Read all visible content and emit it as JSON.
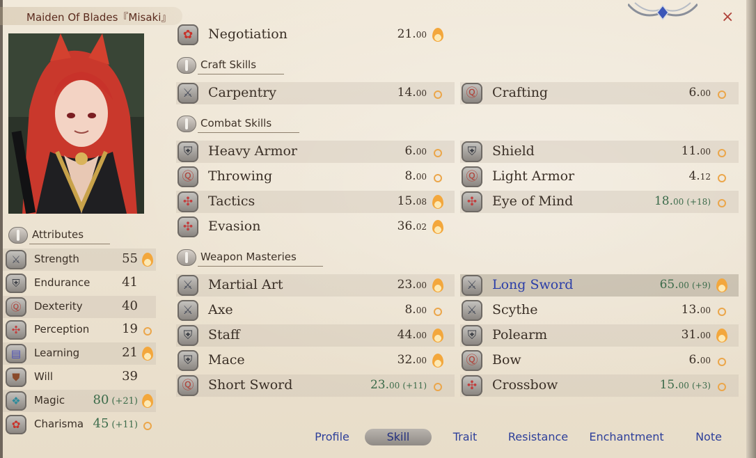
{
  "window": {
    "title": "Maiden Of Blades『Misaki』",
    "close_label": "×"
  },
  "attributes_header": "Attributes",
  "attributes": [
    {
      "name": "Strength",
      "value": "55",
      "bonus": "",
      "potential": "flame",
      "icon": "crossed-swords-icon"
    },
    {
      "name": "Endurance",
      "value": "41",
      "bonus": "",
      "potential": "none",
      "icon": "armor-icon"
    },
    {
      "name": "Dexterity",
      "value": "40",
      "bonus": "",
      "potential": "none",
      "icon": "dexterity-icon"
    },
    {
      "name": "Perception",
      "value": "19",
      "bonus": "",
      "potential": "dot",
      "icon": "perception-icon"
    },
    {
      "name": "Learning",
      "value": "21",
      "bonus": "",
      "potential": "flame",
      "icon": "book-icon"
    },
    {
      "name": "Will",
      "value": "39",
      "bonus": "",
      "potential": "none",
      "icon": "will-icon"
    },
    {
      "name": "Magic",
      "value": "80",
      "bonus": "(+21)",
      "potential": "flame",
      "icon": "magic-icon"
    },
    {
      "name": "Charisma",
      "value": "45",
      "bonus": "(+11)",
      "potential": "dot",
      "icon": "charisma-icon"
    }
  ],
  "top_skill": {
    "name": "Negotiation",
    "value": "21.",
    "decimal": "00",
    "bonus": "",
    "potential": "flame",
    "icon": "charisma-icon"
  },
  "sections": {
    "craft": "Craft Skills",
    "combat": "Combat Skills",
    "weapon": "Weapon Masteries"
  },
  "craft_skills": [
    {
      "name": "Carpentry",
      "value": "14.",
      "decimal": "00",
      "bonus": "",
      "potential": "dot",
      "icon": "crossed-swords-icon"
    },
    {
      "name": "Crafting",
      "value": "6.",
      "decimal": "00",
      "bonus": "",
      "potential": "dot",
      "icon": "dexterity-icon"
    }
  ],
  "combat_skills": [
    {
      "name": "Heavy Armor",
      "value": "6.",
      "decimal": "00",
      "bonus": "",
      "potential": "dot",
      "icon": "armor-icon"
    },
    {
      "name": "Shield",
      "value": "11.",
      "decimal": "00",
      "bonus": "",
      "potential": "dot",
      "icon": "armor-icon"
    },
    {
      "name": "Throwing",
      "value": "8.",
      "decimal": "00",
      "bonus": "",
      "potential": "dot",
      "icon": "dexterity-icon"
    },
    {
      "name": "Light Armor",
      "value": "4.",
      "decimal": "12",
      "bonus": "",
      "potential": "dot",
      "icon": "dexterity-icon"
    },
    {
      "name": "Tactics",
      "value": "15.",
      "decimal": "08",
      "bonus": "",
      "potential": "flame",
      "icon": "perception-icon"
    },
    {
      "name": "Eye of Mind",
      "value": "18.",
      "decimal": "00",
      "bonus": "(+18)",
      "potential": "dot",
      "icon": "perception-icon"
    },
    {
      "name": "Evasion",
      "value": "36.",
      "decimal": "02",
      "bonus": "",
      "potential": "flame",
      "icon": "perception-icon"
    }
  ],
  "weapon_skills": [
    {
      "name": "Martial Art",
      "value": "23.",
      "decimal": "00",
      "bonus": "",
      "potential": "flame",
      "icon": "crossed-swords-icon"
    },
    {
      "name": "Long Sword",
      "value": "65.",
      "decimal": "00",
      "bonus": "(+9)",
      "potential": "flame",
      "icon": "crossed-swords-icon",
      "highlighted": true
    },
    {
      "name": "Axe",
      "value": "8.",
      "decimal": "00",
      "bonus": "",
      "potential": "dot",
      "icon": "crossed-swords-icon"
    },
    {
      "name": "Scythe",
      "value": "13.",
      "decimal": "00",
      "bonus": "",
      "potential": "dot",
      "icon": "crossed-swords-icon"
    },
    {
      "name": "Staff",
      "value": "44.",
      "decimal": "00",
      "bonus": "",
      "potential": "flame",
      "icon": "armor-icon"
    },
    {
      "name": "Polearm",
      "value": "31.",
      "decimal": "00",
      "bonus": "",
      "potential": "flame",
      "icon": "armor-icon"
    },
    {
      "name": "Mace",
      "value": "32.",
      "decimal": "00",
      "bonus": "",
      "potential": "flame",
      "icon": "armor-icon"
    },
    {
      "name": "Bow",
      "value": "6.",
      "decimal": "00",
      "bonus": "",
      "potential": "dot",
      "icon": "dexterity-icon"
    },
    {
      "name": "Short Sword",
      "value": "23.",
      "decimal": "00",
      "bonus": "(+11)",
      "potential": "dot",
      "icon": "dexterity-icon"
    },
    {
      "name": "Crossbow",
      "value": "15.",
      "decimal": "00",
      "bonus": "(+3)",
      "potential": "dot",
      "icon": "perception-icon"
    }
  ],
  "tabs": [
    {
      "label": "Profile",
      "active": false
    },
    {
      "label": "Skill",
      "active": true
    },
    {
      "label": "Trait",
      "active": false
    },
    {
      "label": "Resistance",
      "active": false
    },
    {
      "label": "Enchantment",
      "active": false
    },
    {
      "label": "Note",
      "active": false
    }
  ],
  "colors": {
    "accent_blue": "#2b3ea8",
    "bonus_green": "#3b6b4a",
    "close_red": "#b0433a",
    "flame_orange": "#f3a73c"
  }
}
